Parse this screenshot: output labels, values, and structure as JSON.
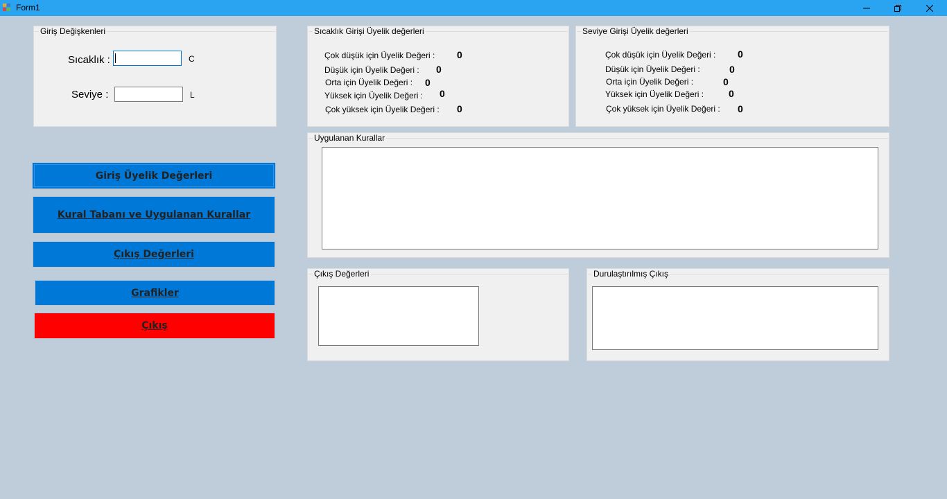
{
  "window": {
    "title": "Form1"
  },
  "inputs_group": {
    "title": "Giriş Değişkenleri",
    "temperature_label": "Sıcaklık :",
    "temperature_unit": "C",
    "temperature_value": "",
    "level_label": "Seviye :",
    "level_unit": "L",
    "level_value": ""
  },
  "temp_membership": {
    "title": "Sıcaklık Girişi Üyelik değerleri",
    "rows": [
      {
        "label": "Çok düşük için Üyelik Değeri :",
        "value": "0"
      },
      {
        "label": "Düşük için Üyelik Değeri :",
        "value": "0"
      },
      {
        "label": "Orta için Üyelik Değeri :",
        "value": "0"
      },
      {
        "label": "Yüksek için Üyelik Değeri :",
        "value": "0"
      },
      {
        "label": "Çok yüksek için Üyelik Değeri :",
        "value": "0"
      }
    ]
  },
  "level_membership": {
    "title": "Seviye Girişi Üyelik değerleri",
    "rows": [
      {
        "label": "Çok düşük için Üyelik Değeri :",
        "value": "0"
      },
      {
        "label": "Düşük için Üyelik Değeri :",
        "value": "0"
      },
      {
        "label": "Orta için Üyelik Değeri :",
        "value": "0"
      },
      {
        "label": "Yüksek için Üyelik Değeri :",
        "value": "0"
      },
      {
        "label": "Çok yüksek için Üyelik Değeri :",
        "value": "0"
      }
    ]
  },
  "rules_group": {
    "title": "Uygulanan Kurallar",
    "content": ""
  },
  "output_group": {
    "title": "Çıkış Değerleri",
    "content": ""
  },
  "defuzz_group": {
    "title": "Durulaştırılmış Çıkış",
    "content": ""
  },
  "buttons": {
    "membership": "Giriş Üyelik Değerleri",
    "rules": "Kural Tabanı ve Uygulanan Kurallar",
    "outputs": "Çıkış Değerleri",
    "charts": "Grafikler",
    "exit": "Çıkış"
  },
  "colors": {
    "background": "#bfcddb",
    "titlebar": "#2aa3f0",
    "button_blue": "#0078d7",
    "button_red": "#ff0000"
  }
}
